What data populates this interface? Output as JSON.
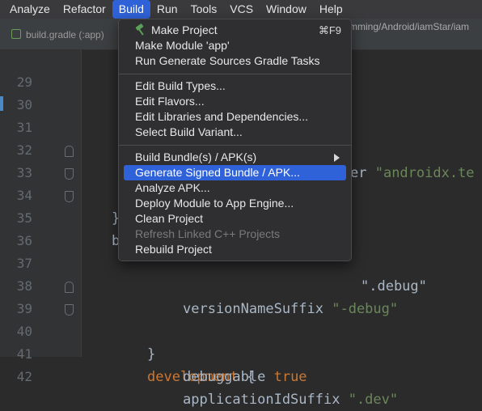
{
  "menubar": {
    "items": [
      "Analyze",
      "Refactor",
      "Build",
      "Run",
      "Tools",
      "VCS",
      "Window",
      "Help"
    ],
    "active": "Build"
  },
  "tabs": {
    "file_tab": "build.gradle (:app)",
    "path_fragment": "mming/Android/iamStar/iam"
  },
  "editor": {
    "lines": [
      {
        "n": "29",
        "code": ""
      },
      {
        "n": "30",
        "code": ""
      },
      {
        "n": "31",
        "code": ""
      },
      {
        "n": "32",
        "code": "er \"androidx.te"
      },
      {
        "n": "33",
        "code": "}"
      },
      {
        "n": "34",
        "code": "b"
      },
      {
        "n": "35",
        "code": ""
      },
      {
        "n": "36",
        "code": ""
      },
      {
        "n": "37",
        "code": "\".debug\""
      },
      {
        "n": "38",
        "code": "versionNameSuffix \"-debug\""
      },
      {
        "n": "39",
        "code": "}"
      },
      {
        "n": "40",
        "code": "development {"
      },
      {
        "n": "41",
        "code": "debuggable true"
      },
      {
        "n": "42",
        "code": "applicationIdSuffix \".dev\""
      }
    ]
  },
  "build_menu": {
    "items": [
      {
        "label": "Make Project",
        "icon": "hammer-icon",
        "shortcut": "⌘F9"
      },
      {
        "label": "Make Module 'app'"
      },
      {
        "label": "Run Generate Sources Gradle Tasks"
      },
      {
        "label": "Edit Build Types..."
      },
      {
        "label": "Edit Flavors..."
      },
      {
        "label": "Edit Libraries and Dependencies..."
      },
      {
        "label": "Select Build Variant..."
      },
      {
        "label": "Build Bundle(s) / APK(s)",
        "submenu": true
      },
      {
        "label": "Generate Signed Bundle / APK...",
        "highlighted": true
      },
      {
        "label": "Analyze APK..."
      },
      {
        "label": "Deploy Module to App Engine..."
      },
      {
        "label": "Clean Project"
      },
      {
        "label": "Refresh Linked C++ Projects",
        "disabled": true
      },
      {
        "label": "Rebuild Project"
      }
    ]
  },
  "colors": {
    "accent": "#2f62d8",
    "keyword": "#cc7832",
    "string": "#6a8759",
    "text": "#a9b7c6"
  }
}
